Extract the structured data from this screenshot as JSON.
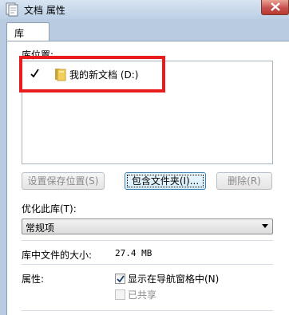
{
  "window": {
    "title": "文档 属性"
  },
  "tabs": [
    {
      "label": "库"
    }
  ],
  "library": {
    "locations_label": "库位置:",
    "locations": [
      {
        "name": "我的新文档 (D:)",
        "checked": true
      }
    ]
  },
  "buttons": {
    "set_save_location": "设置保存位置(S)",
    "include_folder": "包含文件夹(I)...",
    "remove": "删除(R)"
  },
  "optimize": {
    "label": "优化此库(T):",
    "selected": "常规项"
  },
  "size": {
    "label": "库中文件的大小:",
    "value": "27.4 MB"
  },
  "attributes": {
    "label": "属性:",
    "show_in_nav": {
      "label": "显示在导航窗格中(N)",
      "checked": true
    },
    "shared": {
      "label": "已共享",
      "checked": false
    }
  },
  "colors": {
    "highlight": "#e81c1c",
    "close": "#c75050"
  }
}
